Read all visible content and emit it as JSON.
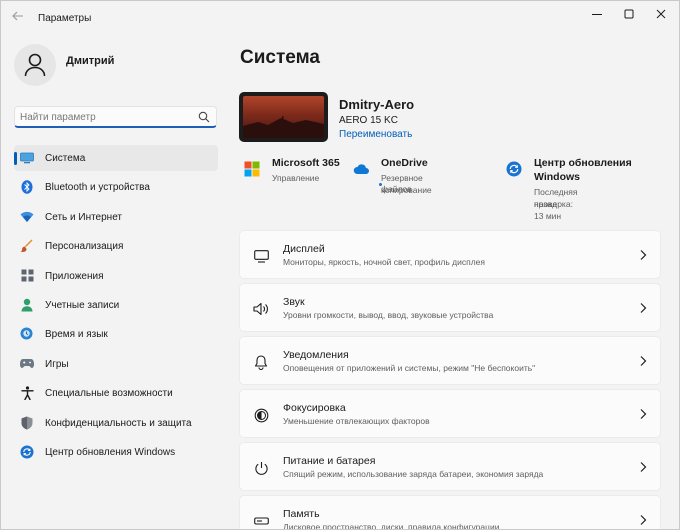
{
  "window": {
    "title": "Параметры"
  },
  "user": {
    "name": "Дмитрий"
  },
  "search": {
    "placeholder": "Найти параметр"
  },
  "sidebar": {
    "items": [
      {
        "label": "Система",
        "icon": "display-icon",
        "active": true
      },
      {
        "label": "Bluetooth и устройства",
        "icon": "bluetooth-icon"
      },
      {
        "label": "Сеть и Интернет",
        "icon": "wifi-icon"
      },
      {
        "label": "Персонализация",
        "icon": "brush-icon"
      },
      {
        "label": "Приложения",
        "icon": "apps-icon"
      },
      {
        "label": "Учетные записи",
        "icon": "account-icon"
      },
      {
        "label": "Время и язык",
        "icon": "globe-clock-icon"
      },
      {
        "label": "Игры",
        "icon": "gamepad-icon"
      },
      {
        "label": "Специальные возможности",
        "icon": "accessibility-icon"
      },
      {
        "label": "Конфиденциальность и защита",
        "icon": "shield-icon"
      },
      {
        "label": "Центр обновления Windows",
        "icon": "update-icon"
      }
    ]
  },
  "main": {
    "title": "Система",
    "device": {
      "name": "Dmitry-Aero",
      "model": "AERO 15 KC",
      "rename_label": "Переименовать"
    },
    "services": [
      {
        "title": "Microsoft 365",
        "subtitle": [
          "Управление"
        ],
        "icon": "microsoft-365-icon"
      },
      {
        "title": "OneDrive",
        "subtitle": [
          "Резервное копирование",
          "файлов"
        ],
        "icon": "onedrive-icon"
      },
      {
        "title": "Центр обновления",
        "title2": "Windows",
        "subtitle": [
          "Последняя проверка: 13 мин",
          "назад"
        ],
        "icon": "windows-update-icon"
      }
    ],
    "cards": [
      {
        "title": "Дисплей",
        "subtitle": "Мониторы, яркость, ночной свет, профиль дисплея",
        "icon": "monitor-icon"
      },
      {
        "title": "Звук",
        "subtitle": "Уровни громкости, вывод, ввод, звуковые устройства",
        "icon": "speaker-icon"
      },
      {
        "title": "Уведомления",
        "subtitle": "Оповещения от приложений и системы, режим \"Не беспокоить\"",
        "icon": "bell-icon"
      },
      {
        "title": "Фокусировка",
        "subtitle": "Уменьшение отвлекающих факторов",
        "icon": "focus-icon"
      },
      {
        "title": "Питание и батарея",
        "subtitle": "Спящий режим, использование заряда батареи, экономия заряда",
        "icon": "power-icon"
      },
      {
        "title": "Память",
        "subtitle": "Дисковое пространство, диски, правила конфигурации",
        "icon": "storage-icon"
      }
    ]
  },
  "colors": {
    "accent": "#005fb8",
    "background": "#f3f3f3",
    "card": "#fbfbfb"
  }
}
